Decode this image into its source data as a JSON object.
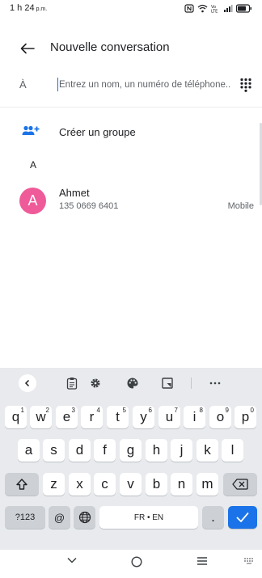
{
  "status_bar": {
    "time": "1 h 24",
    "time_suffix": "p.m."
  },
  "header": {
    "title": "Nouvelle conversation"
  },
  "to_field": {
    "label": "À",
    "placeholder": "Entrez un nom, un numéro de téléphone..."
  },
  "create_group": {
    "label": "Créer un groupe"
  },
  "contacts": {
    "section_letter": "A",
    "items": [
      {
        "initial": "A",
        "name": "Ahmet",
        "phone": "135 0669 6401",
        "type": "Mobile",
        "avatar_color": "#ef5a99"
      }
    ]
  },
  "keyboard": {
    "row1": [
      {
        "key": "q",
        "hint": "1"
      },
      {
        "key": "w",
        "hint": "2"
      },
      {
        "key": "e",
        "hint": "3"
      },
      {
        "key": "r",
        "hint": "4"
      },
      {
        "key": "t",
        "hint": "5"
      },
      {
        "key": "y",
        "hint": "6"
      },
      {
        "key": "u",
        "hint": "7"
      },
      {
        "key": "i",
        "hint": "8"
      },
      {
        "key": "o",
        "hint": "9"
      },
      {
        "key": "p",
        "hint": "0"
      }
    ],
    "row2": [
      "a",
      "s",
      "d",
      "f",
      "g",
      "h",
      "j",
      "k",
      "l"
    ],
    "row3": [
      "z",
      "x",
      "c",
      "v",
      "b",
      "n",
      "m"
    ],
    "symbols_label": "?123",
    "at_label": "@",
    "space_label": "FR • EN",
    "period_label": "."
  },
  "colors": {
    "accent": "#1a73e8",
    "keyboard_bg": "#e8eaed"
  }
}
